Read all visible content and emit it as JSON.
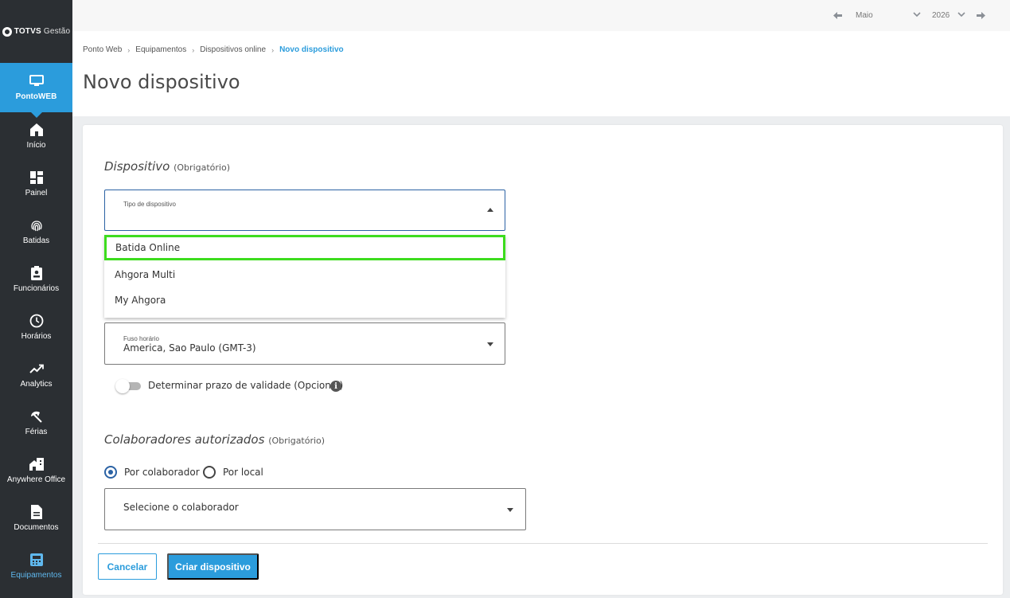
{
  "brand": {
    "name_bold": "TOTVS",
    "name_light": "Gestão"
  },
  "sidebar": {
    "items": [
      {
        "label": "PontoWEB",
        "icon": "monitor-icon"
      },
      {
        "label": "Início",
        "icon": "home-icon"
      },
      {
        "label": "Painel",
        "icon": "dashboard-icon"
      },
      {
        "label": "Batidas",
        "icon": "fingerprint-icon"
      },
      {
        "label": "Funcionários",
        "icon": "badge-icon"
      },
      {
        "label": "Horários",
        "icon": "clock-icon"
      },
      {
        "label": "Analytics",
        "icon": "trend-icon"
      },
      {
        "label": "Férias",
        "icon": "beach-umbrella-icon"
      },
      {
        "label": "Anywhere Office",
        "icon": "home-work-icon"
      },
      {
        "label": "Documentos",
        "icon": "document-icon"
      },
      {
        "label": "Equipamentos",
        "icon": "device-icon"
      }
    ]
  },
  "topbar": {
    "month": "Maio",
    "year": "2026"
  },
  "breadcrumb": [
    "Ponto Web",
    "Equipamentos",
    "Dispositivos online",
    "Novo dispositivo"
  ],
  "page_title": "Novo dispositivo",
  "device_section": {
    "title": "Dispositivo",
    "qualifier": "(Obrigatório)",
    "type_field": {
      "label": "Tipo de dispositivo",
      "value": ""
    },
    "options": [
      "Batida Online",
      "Ahgora Multi",
      "My Ahgora"
    ],
    "timezone_field": {
      "label": "Fuso horário",
      "value": "America, Sao Paulo (GMT-3)"
    },
    "validity_toggle": {
      "label": "Determinar prazo de validade (Opcional)",
      "on": false
    }
  },
  "collaborators_section": {
    "title": "Colaboradores autorizados",
    "qualifier": "(Obrigatório)",
    "radio_by_collaborator": "Por colaborador",
    "radio_by_location": "Por local",
    "selected_radio": "Por colaborador",
    "select_placeholder": "Selecione o colaborador"
  },
  "actions": {
    "cancel": "Cancelar",
    "create": "Criar dispositivo"
  },
  "colors": {
    "accent": "#2b9cdc",
    "sidebar_bg": "#2b2f33",
    "highlight_border": "#3ddc1e",
    "focus_border": "#2b62a4"
  }
}
